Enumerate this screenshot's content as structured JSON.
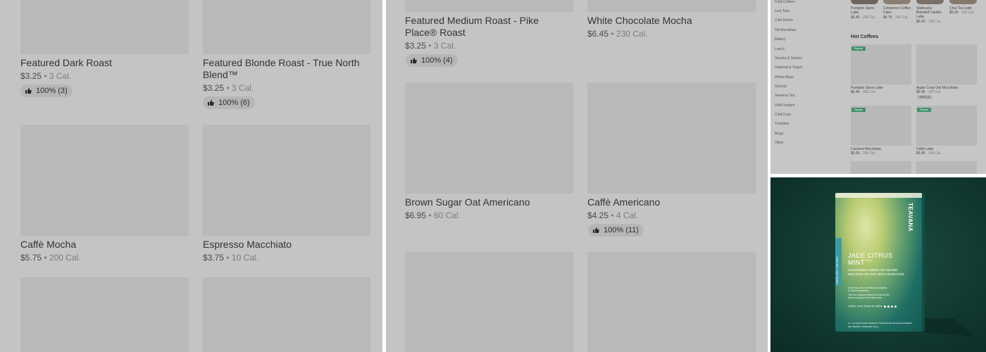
{
  "colors": {
    "overlay": "#c4c4c4",
    "tile": "#b9b9b9",
    "teal_bg": "#103a31",
    "popular_tag": "#3f8f6a"
  },
  "panel1": {
    "items": [
      {
        "name": "Featured Dark Roast",
        "price": "$3.25",
        "cal": "3 Cal.",
        "rating": "100% (3)"
      },
      {
        "name": "Featured Blonde Roast - True North Blend™",
        "price": "$3.25",
        "cal": "3 Cal.",
        "rating": "100% (6)"
      },
      {
        "name": "Caffè Mocha",
        "price": "$5.75",
        "cal": "200 Cal."
      },
      {
        "name": "Espresso Macchiato",
        "price": "$3.75",
        "cal": "10 Cal."
      }
    ]
  },
  "panel2": {
    "items": [
      {
        "name": "Featured Medium Roast - Pike Place® Roast",
        "price": "$3.25",
        "cal": "3 Cal.",
        "rating": "100% (4)"
      },
      {
        "name": "White Chocolate Mocha",
        "price": "$6.45",
        "cal": "230 Cal."
      },
      {
        "name": "Brown Sugar Oat Americano",
        "price": "$6.95",
        "cal": "60 Cal."
      },
      {
        "name": "Caffè Americano",
        "price": "$4.25",
        "cal": "4 Cal.",
        "rating": "100% (11)"
      }
    ]
  },
  "thumb": {
    "sidebar": [
      "Cold Coffees",
      "Iced Teas",
      "Cold Drinks",
      "Hot Breakfast",
      "Bakery",
      "Lunch",
      "Snacks & Sweets",
      "Oatmeal & Yogurt",
      "Whole Bean",
      "Ground",
      "Teavana Tea",
      "VIA® Instant",
      "Cold Cups",
      "Tumblers",
      "Mugs",
      "Other"
    ],
    "top_row": [
      {
        "name": "Pumpkin Spice Latte",
        "price": "$6.45",
        "cal": "· 390 Cal."
      },
      {
        "name": "Cinnamon Coffee Cake",
        "price": "$4.75",
        "cal": "· 330 Cal."
      },
      {
        "name": "Starbucks Blonde® Vanilla Latte",
        "price": "$6.25",
        "cal": "· 190 Cal."
      },
      {
        "name": "Chai Tea Latte",
        "price": "$5.95",
        "cal": "· 240 Cal."
      }
    ],
    "section_title": "Hot Coffees",
    "popular_label": "Popular",
    "grid": [
      {
        "name": "Pumpkin Spice Latte",
        "price": "$6.45",
        "cal": "· 390 Cal."
      },
      {
        "name": "Apple Crisp Oat Macchiato",
        "price": "$6.95",
        "cal": "· 300 Cal.",
        "rating": "100% (3)"
      },
      {
        "name": "Caramel Macchiato",
        "price": "$5.95",
        "cal": "· 250 Cal."
      },
      {
        "name": "Caffè Latte",
        "price": "$5.45",
        "cal": "· 190 Cal."
      }
    ]
  },
  "product": {
    "brand": "TEAVANA",
    "name_line1": "JADE CITRUS",
    "name_line2": "MINT",
    "tm": "TM/MC",
    "subtitle1": "FLAVOURED GREEN TEA BLEND",
    "subtitle2": "MÉLANGE DE THÉ VERT AROMATISÉ",
    "side_label": "GREEN TEA / THÉ VERT",
    "desc1": "Green tea, lemon verbena, lemongrass",
    "desc2": "& a hint of spearmint.",
    "desc3": "Thé vert, verveine citronnée et citronnelle",
    "desc4": "avec un soupçon de menthe verte.",
    "caffeine": "Caffeine Level / Niveau de caféine",
    "footer1": "12 × 1.6 g FULL LEAF SACHETS / SACHETS DE FEUILLES ENTIÈRES",
    "footer2": "NET WEIGHT / POIDS NET 19.2 g"
  }
}
